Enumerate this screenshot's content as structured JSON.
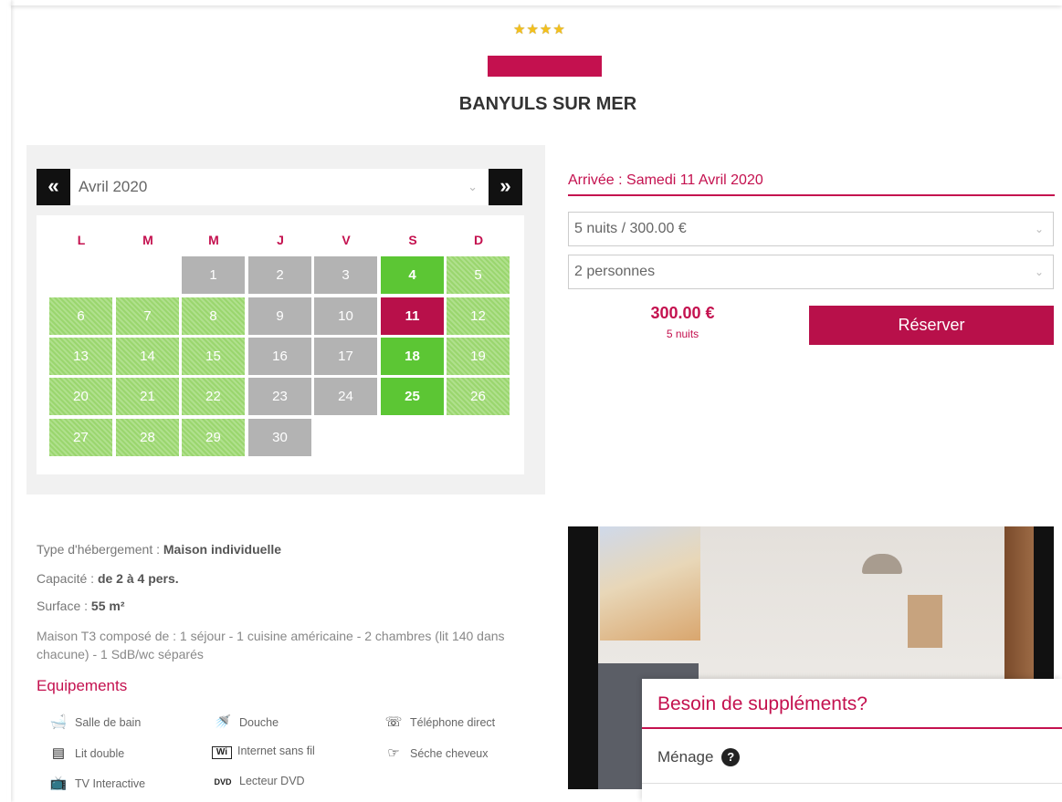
{
  "header": {
    "stars": "★★★★",
    "title": "BANYULS SUR MER",
    "accent_color": "#c4114f"
  },
  "calendar": {
    "prev_label": "«",
    "next_label": "»",
    "month": "Avril 2020",
    "weekdays": [
      "L",
      "M",
      "M",
      "J",
      "V",
      "S",
      "D"
    ],
    "days": [
      {
        "n": "1",
        "status": "unavailable"
      },
      {
        "n": "2",
        "status": "unavailable"
      },
      {
        "n": "3",
        "status": "unavailable"
      },
      {
        "n": "4",
        "status": "arrival"
      },
      {
        "n": "5",
        "status": "available"
      },
      {
        "n": "6",
        "status": "available"
      },
      {
        "n": "7",
        "status": "available"
      },
      {
        "n": "8",
        "status": "available"
      },
      {
        "n": "9",
        "status": "unavailable"
      },
      {
        "n": "10",
        "status": "unavailable"
      },
      {
        "n": "11",
        "status": "selected"
      },
      {
        "n": "12",
        "status": "available"
      },
      {
        "n": "13",
        "status": "available"
      },
      {
        "n": "14",
        "status": "available"
      },
      {
        "n": "15",
        "status": "available"
      },
      {
        "n": "16",
        "status": "unavailable"
      },
      {
        "n": "17",
        "status": "unavailable"
      },
      {
        "n": "18",
        "status": "arrival"
      },
      {
        "n": "19",
        "status": "available"
      },
      {
        "n": "20",
        "status": "available"
      },
      {
        "n": "21",
        "status": "available"
      },
      {
        "n": "22",
        "status": "available"
      },
      {
        "n": "23",
        "status": "unavailable"
      },
      {
        "n": "24",
        "status": "unavailable"
      },
      {
        "n": "25",
        "status": "arrival"
      },
      {
        "n": "26",
        "status": "available"
      },
      {
        "n": "27",
        "status": "available"
      },
      {
        "n": "28",
        "status": "available"
      },
      {
        "n": "29",
        "status": "available"
      },
      {
        "n": "30",
        "status": "unavailable"
      }
    ],
    "first_weekday_index": 2
  },
  "booking": {
    "arrival": "Arrivée : Samedi 11 Avril 2020",
    "nights_select": "5 nuits / 300.00 €",
    "persons_select": "2 personnes",
    "price": "300.00 €",
    "price_sub": "5 nuits",
    "book_label": "Réserver"
  },
  "info": {
    "type_label": "Type d'hébergement : ",
    "type_value": "Maison individuelle",
    "capacity_label": "Capacité : ",
    "capacity_value": "de 2 à 4 pers.",
    "surface_label": "Surface : ",
    "surface_value": "55 m²",
    "description": "Maison T3 composé de : 1 séjour - 1 cuisine américaine - 2 chambres (lit 140 dans chacune) - 1 SdB/wc séparés"
  },
  "equipements": {
    "title": "Equipements",
    "items": [
      {
        "label": "Salle de bain",
        "icon": "bathtub-icon"
      },
      {
        "label": "Douche",
        "icon": "shower-icon"
      },
      {
        "label": "Téléphone direct",
        "icon": "telephone-icon"
      },
      {
        "label": "Lit double",
        "icon": "double-bed-icon"
      },
      {
        "label": "Internet sans fil",
        "icon": "wifi-icon"
      },
      {
        "label": "Séche cheveux",
        "icon": "hair-dryer-icon"
      },
      {
        "label": "TV Interactive",
        "icon": "tv-icon"
      },
      {
        "label": "Lecteur DVD",
        "icon": "dvd-icon"
      }
    ]
  },
  "supplements": {
    "title": "Besoin de suppléments?",
    "item": "Ménage",
    "help": "?"
  }
}
